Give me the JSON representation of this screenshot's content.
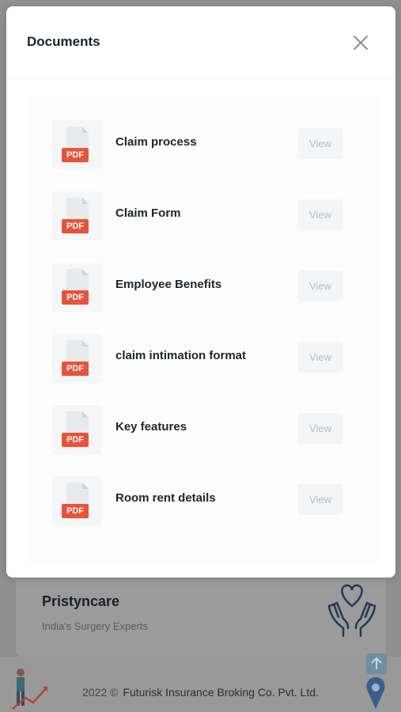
{
  "modal": {
    "title": "Documents",
    "close_icon": "close-icon",
    "documents": [
      {
        "name": "Claim process",
        "badge": "PDF",
        "action": "View"
      },
      {
        "name": "Claim Form",
        "badge": "PDF",
        "action": "View"
      },
      {
        "name": "Employee Benefits",
        "badge": "PDF",
        "action": "View"
      },
      {
        "name": "claim intimation format",
        "badge": "PDF",
        "action": "View"
      },
      {
        "name": "Key features",
        "badge": "PDF",
        "action": "View"
      },
      {
        "name": "Room rent details",
        "badge": "PDF",
        "action": "View"
      }
    ]
  },
  "background": {
    "card": {
      "title": "Pristyncare",
      "subtitle": "India's Surgery Experts",
      "icon": "hands-heart-icon"
    },
    "footer": {
      "year": "2022 ©",
      "company": "Futurisk Insurance Broking Co. Pvt. Ltd."
    }
  },
  "colors": {
    "pdf_badge": "#e8533a",
    "overlay": "#8f8f8f",
    "title_text": "#1b2133",
    "view_text": "#b7bcc4"
  }
}
